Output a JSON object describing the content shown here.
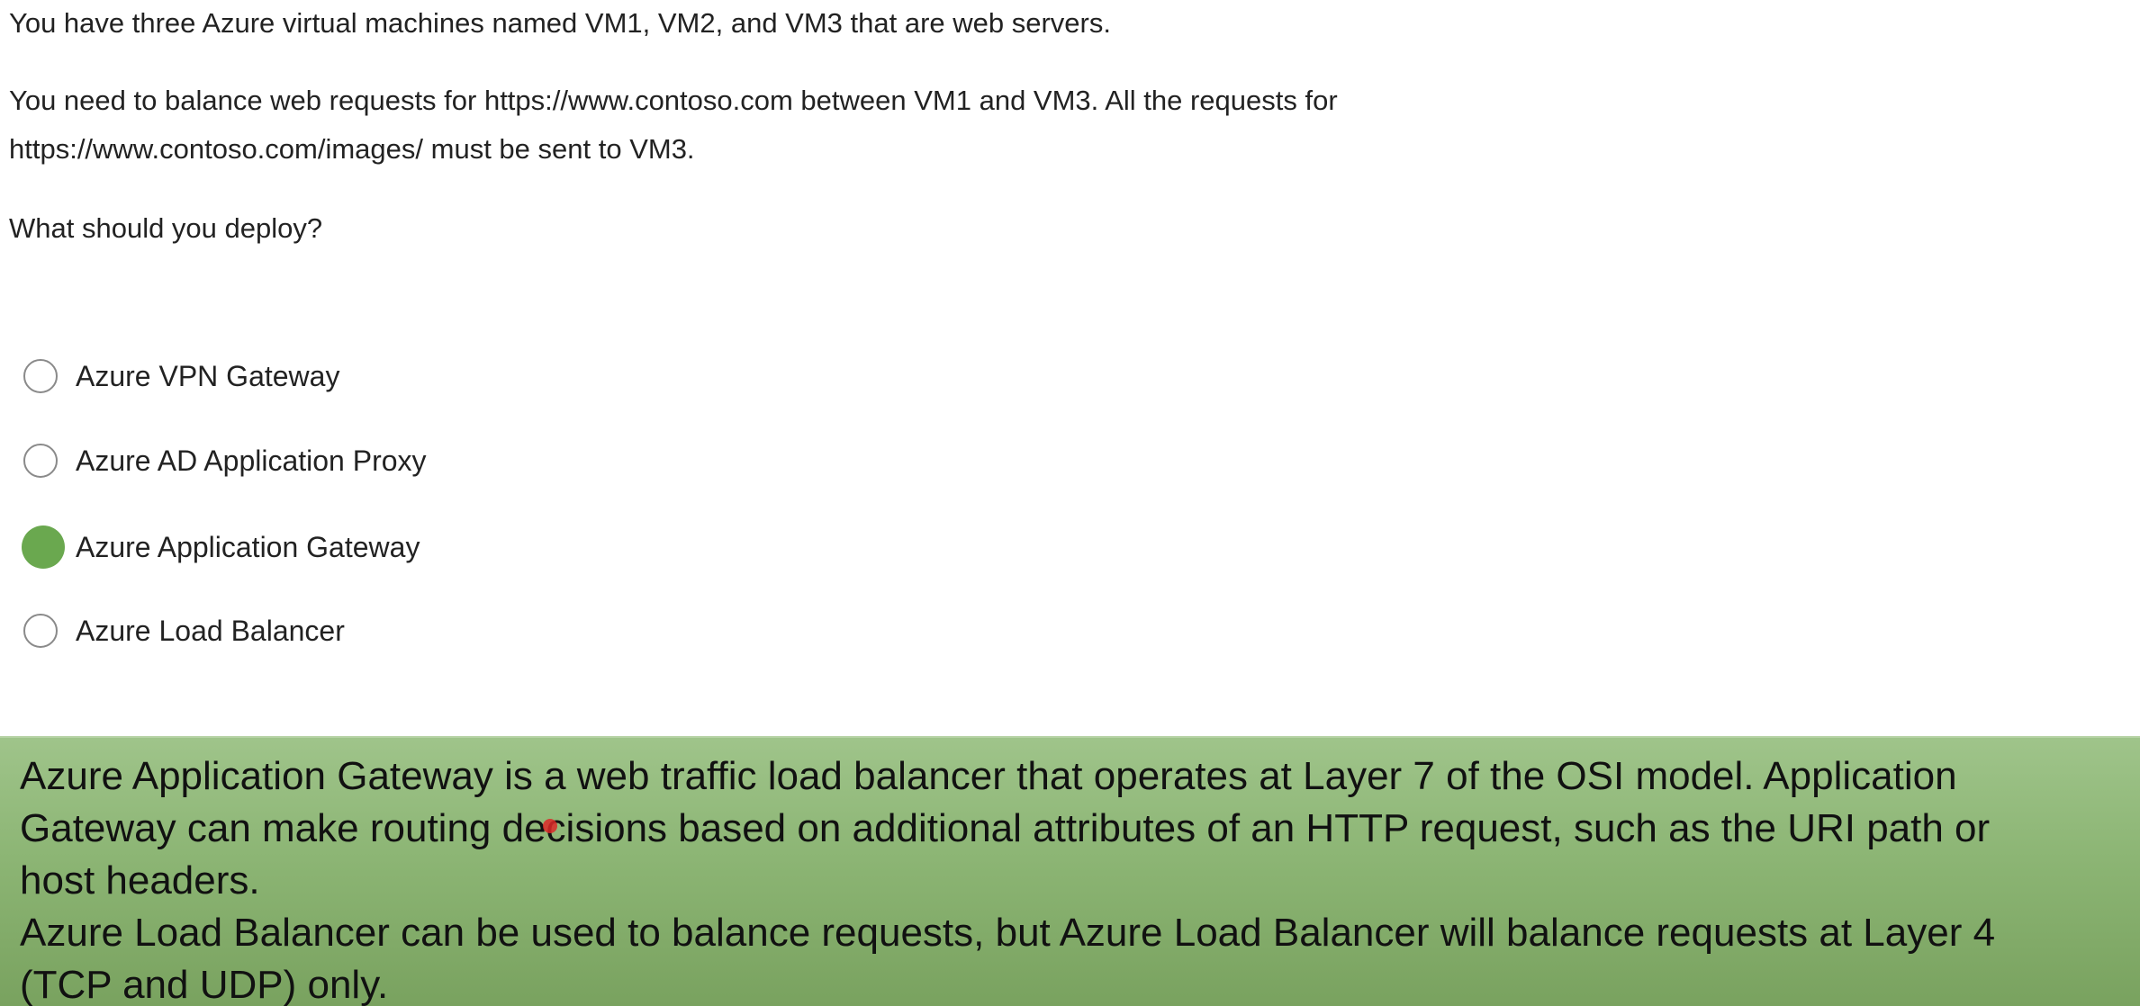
{
  "question": {
    "line1": "You have three Azure virtual machines named VM1, VM2, and VM3 that are web servers.",
    "line2": "You need to balance web requests for https://www.contoso.com between VM1 and VM3. All the requests for",
    "line3": "https://www.contoso.com/images/ must be sent to VM3.",
    "prompt": "What should you deploy?"
  },
  "options": [
    {
      "label": "Azure VPN Gateway",
      "selected": false
    },
    {
      "label": "Azure AD Application Proxy",
      "selected": false
    },
    {
      "label": "Azure Application Gateway",
      "selected": true
    },
    {
      "label": "Azure Load Balancer",
      "selected": false
    }
  ],
  "explanation": {
    "line1": "Azure Application Gateway is a web traffic load balancer that operates at Layer 7 of the OSI model. Application",
    "line2": "Gateway can make routing decisions based on additional attributes of an HTTP request, such as the URI path or",
    "line3": "host headers.",
    "line4": "Azure Load Balancer can be used to balance requests, but Azure Load Balancer will balance requests at Layer 4",
    "line5": "(TCP and UDP) only."
  },
  "colors": {
    "selected_radio": "#6aa84f",
    "explanation_background": "#8cb574"
  }
}
